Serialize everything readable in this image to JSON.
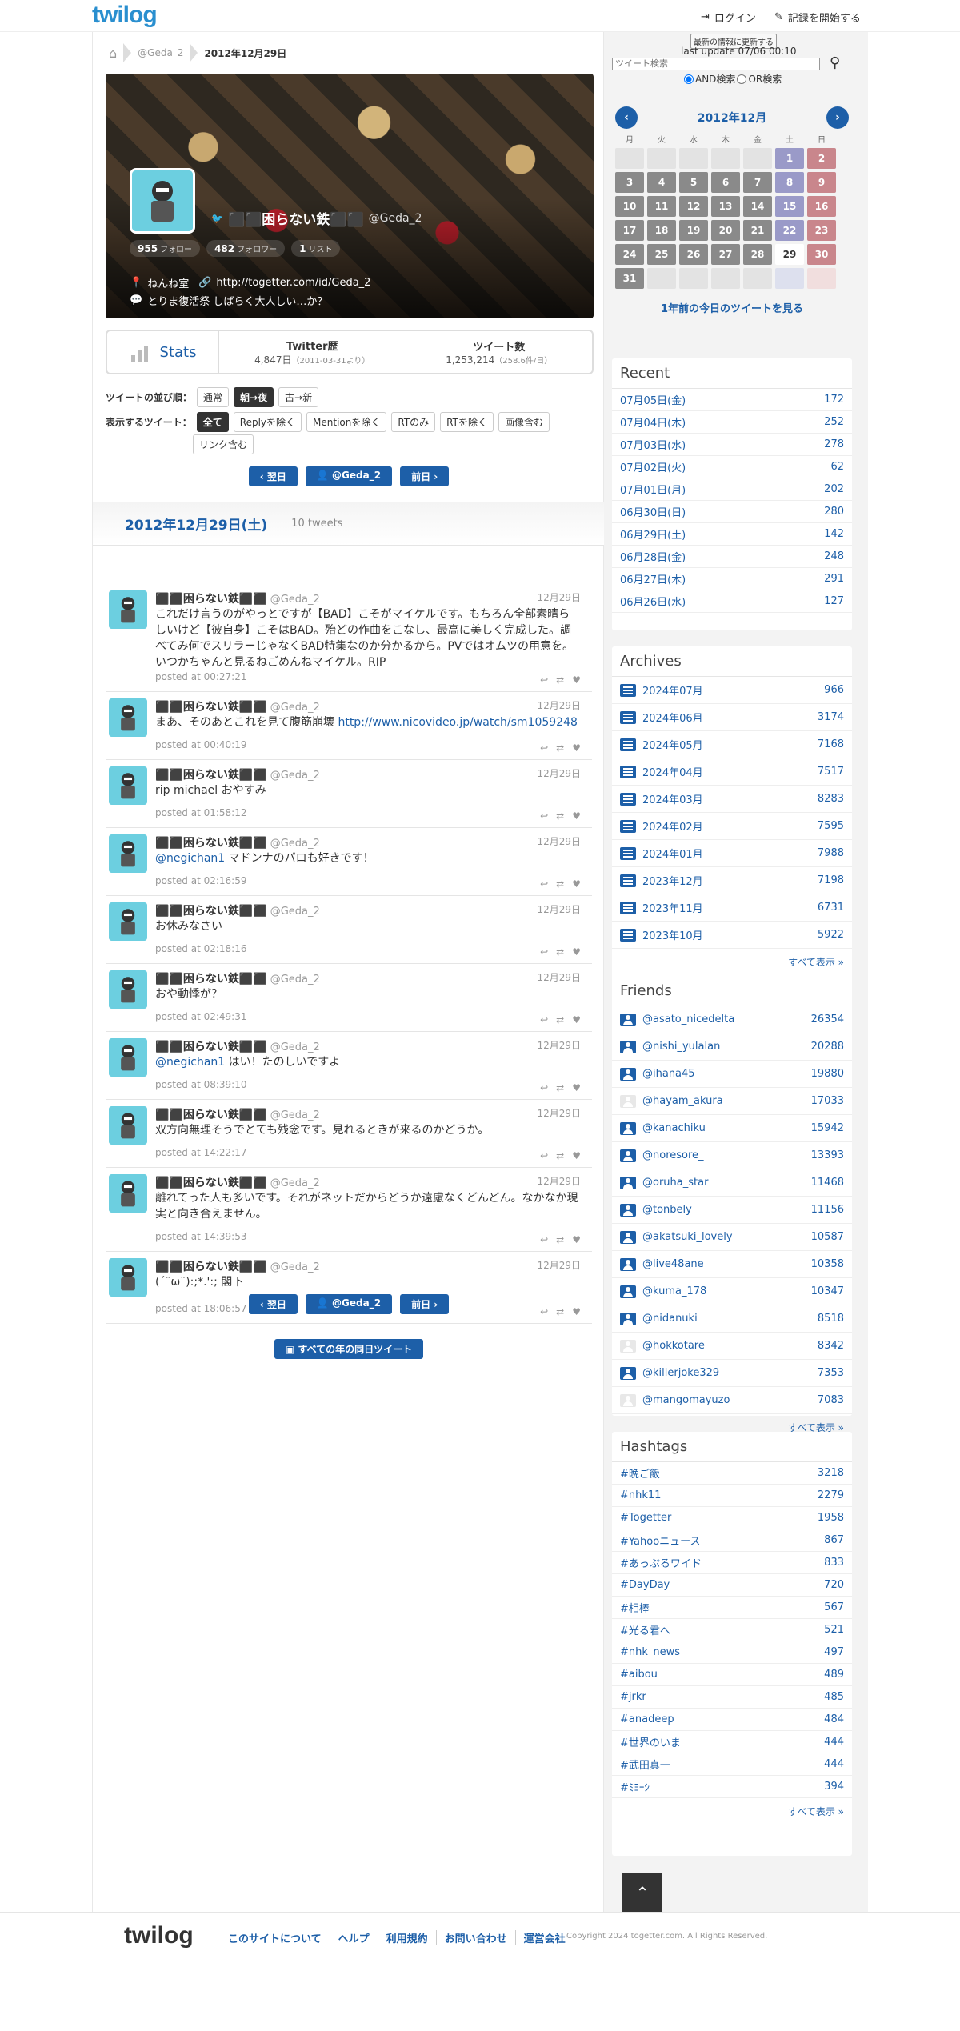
{
  "header": {
    "logo": "twilog",
    "login": "ログイン",
    "start": "記録を開始する"
  },
  "breadcrumb": {
    "user": "@Geda_2",
    "date": "2012年12月29日"
  },
  "profile": {
    "name": "⬛⬛困らない鉄⬛⬛",
    "handle": "@Geda_2",
    "follow_count": "955",
    "follow_label": "フォロー",
    "follower_count": "482",
    "follower_label": "フォロワー",
    "list_count": "1",
    "list_label": "リスト",
    "location": "ねんね室",
    "url": "http://togetter.com/id/Geda_2",
    "bio": "とりま復活祭 しばらく大人しい…か？"
  },
  "stats": {
    "label": "Stats",
    "history_title": "Twitter歴",
    "history_value": "4,847日",
    "history_sub": "（2011-03-31より）",
    "count_title": "ツイート数",
    "count_value": "1,253,214",
    "count_sub": "（258.6件/日）"
  },
  "filters": {
    "order_label": "ツイートの並び順：",
    "order": [
      "通常",
      "朝→夜",
      "古→新"
    ],
    "show_label": "表示するツイート：",
    "show": [
      "全て",
      "Replyを除く",
      "Mentionを除く",
      "RTのみ",
      "RTを除く",
      "画像含む"
    ],
    "show2": "リンク含む"
  },
  "nav": {
    "prev": "翌日",
    "user": "@Geda_2",
    "next": "前日",
    "all_years": "すべての年の同日ツイート"
  },
  "day": {
    "title": "2012年12月29日(土)",
    "count": "10 tweets"
  },
  "tweets": [
    {
      "name": "⬛⬛困らない鉄⬛⬛",
      "handle": "@Geda_2",
      "date": "12月29日",
      "text": "これだけ言うのがやっとですが【BAD】こそがマイケルです。もちろん全部素晴らしいけど【彼自身】こそはBAD。殆どの作曲をこなし、最高に美しく完成した。調べてみ何でスリラーじゃなくBAD特集なのか分かるから。PVではオムツの用意を。いつかちゃんと見るねごめんねマイケル。RIP",
      "posted": "posted at 00:27:21"
    },
    {
      "name": "⬛⬛困らない鉄⬛⬛",
      "handle": "@Geda_2",
      "date": "12月29日",
      "text": "まあ、そのあとこれを見て腹筋崩壊 ",
      "link": "http://www.nicovideo.jp/watch/sm1059248",
      "posted": "posted at 00:40:19"
    },
    {
      "name": "⬛⬛困らない鉄⬛⬛",
      "handle": "@Geda_2",
      "date": "12月29日",
      "text": "rip michael おやすみ",
      "posted": "posted at 01:58:12"
    },
    {
      "name": "⬛⬛困らない鉄⬛⬛",
      "handle": "@Geda_2",
      "date": "12月29日",
      "mention": "@negichan1",
      "text": " マドンナのパロも好きです！",
      "posted": "posted at 02:16:59"
    },
    {
      "name": "⬛⬛困らない鉄⬛⬛",
      "handle": "@Geda_2",
      "date": "12月29日",
      "text": "お休みなさい",
      "posted": "posted at 02:18:16"
    },
    {
      "name": "⬛⬛困らない鉄⬛⬛",
      "handle": "@Geda_2",
      "date": "12月29日",
      "text": "おや動悸が？",
      "posted": "posted at 02:49:31"
    },
    {
      "name": "⬛⬛困らない鉄⬛⬛",
      "handle": "@Geda_2",
      "date": "12月29日",
      "mention": "@negichan1",
      "text": " はい！たのしいですよ",
      "posted": "posted at 08:39:10"
    },
    {
      "name": "⬛⬛困らない鉄⬛⬛",
      "handle": "@Geda_2",
      "date": "12月29日",
      "text": "双方向無理そうでとても残念です。見れるときが来るのかどうか。",
      "posted": "posted at 14:22:17"
    },
    {
      "name": "⬛⬛困らない鉄⬛⬛",
      "handle": "@Geda_2",
      "date": "12月29日",
      "text": "離れてった人も多いです。それがネットだからどうか遠慮なくどんどん。なかなか現実と向き合えません。",
      "posted": "posted at 14:39:53"
    },
    {
      "name": "⬛⬛困らない鉄⬛⬛",
      "handle": "@Geda_2",
      "date": "12月29日",
      "text": "(´¨ω¨):;*.':; 閣下",
      "posted": "posted at 18:06:57"
    }
  ],
  "search": {
    "update_btn": "最新の情報に更新する",
    "last_update": "last update 07/06 00:10",
    "placeholder": "ツイート検索",
    "and": "AND検索",
    "or": "OR検索"
  },
  "calendar": {
    "title": "2012年12月",
    "weekdays": [
      "月",
      "火",
      "水",
      "木",
      "金",
      "土",
      "日"
    ],
    "days": [
      "",
      "",
      "",
      "",
      "",
      "1",
      "2",
      "3",
      "4",
      "5",
      "6",
      "7",
      "8",
      "9",
      "10",
      "11",
      "12",
      "13",
      "14",
      "15",
      "16",
      "17",
      "18",
      "19",
      "20",
      "21",
      "22",
      "23",
      "24",
      "25",
      "26",
      "27",
      "28",
      "29",
      "30",
      "31",
      "",
      "",
      "",
      "",
      "",
      ""
    ],
    "year_ago": "1年前の今日のツイートを見る"
  },
  "recent": {
    "title": "Recent",
    "items": [
      {
        "label": "07月05日(金)",
        "count": "172"
      },
      {
        "label": "07月04日(木)",
        "count": "252"
      },
      {
        "label": "07月03日(水)",
        "count": "278"
      },
      {
        "label": "07月02日(火)",
        "count": "62"
      },
      {
        "label": "07月01日(月)",
        "count": "202"
      },
      {
        "label": "06月30日(日)",
        "count": "280"
      },
      {
        "label": "06月29日(土)",
        "count": "142"
      },
      {
        "label": "06月28日(金)",
        "count": "248"
      },
      {
        "label": "06月27日(木)",
        "count": "291"
      },
      {
        "label": "06月26日(水)",
        "count": "127"
      }
    ]
  },
  "archives": {
    "title": "Archives",
    "more": "すべて表示 »",
    "items": [
      {
        "label": "2024年07月",
        "count": "966"
      },
      {
        "label": "2024年06月",
        "count": "3174"
      },
      {
        "label": "2024年05月",
        "count": "7168"
      },
      {
        "label": "2024年04月",
        "count": "7517"
      },
      {
        "label": "2024年03月",
        "count": "8283"
      },
      {
        "label": "2024年02月",
        "count": "7595"
      },
      {
        "label": "2024年01月",
        "count": "7988"
      },
      {
        "label": "2023年12月",
        "count": "7198"
      },
      {
        "label": "2023年11月",
        "count": "6731"
      },
      {
        "label": "2023年10月",
        "count": "5922"
      }
    ]
  },
  "friends": {
    "title": "Friends",
    "more": "すべて表示 »",
    "items": [
      {
        "label": "@asato_nicedelta",
        "count": "26354"
      },
      {
        "label": "@nishi_yulalan",
        "count": "20288"
      },
      {
        "label": "@ihana45",
        "count": "19880"
      },
      {
        "label": "@hayam_akura",
        "count": "17033"
      },
      {
        "label": "@kanachiku",
        "count": "15942"
      },
      {
        "label": "@noresore_",
        "count": "13393"
      },
      {
        "label": "@oruha_star",
        "count": "11468"
      },
      {
        "label": "@tonbely",
        "count": "11156"
      },
      {
        "label": "@akatsuki_lovely",
        "count": "10587"
      },
      {
        "label": "@live48ane",
        "count": "10358"
      },
      {
        "label": "@kuma_178",
        "count": "10347"
      },
      {
        "label": "@nidanuki",
        "count": "8518"
      },
      {
        "label": "@hokkotare",
        "count": "8342"
      },
      {
        "label": "@killerjoke329",
        "count": "7353"
      },
      {
        "label": "@mangomayuzo",
        "count": "7083"
      }
    ]
  },
  "hashtags": {
    "title": "Hashtags",
    "more": "すべて表示 »",
    "items": [
      {
        "label": "#晩ご飯",
        "count": "3218"
      },
      {
        "label": "#nhk11",
        "count": "2279"
      },
      {
        "label": "#Togetter",
        "count": "1958"
      },
      {
        "label": "#Yahooニュース",
        "count": "867"
      },
      {
        "label": "#あっぷるワイド",
        "count": "833"
      },
      {
        "label": "#DayDay",
        "count": "720"
      },
      {
        "label": "#相棒",
        "count": "567"
      },
      {
        "label": "#光る君へ",
        "count": "521"
      },
      {
        "label": "#nhk_news",
        "count": "497"
      },
      {
        "label": "#aibou",
        "count": "489"
      },
      {
        "label": "#jrkr",
        "count": "485"
      },
      {
        "label": "#anadeep",
        "count": "484"
      },
      {
        "label": "#世界のいま",
        "count": "444"
      },
      {
        "label": "#武田真一",
        "count": "444"
      },
      {
        "label": "#ﾐﾖｰｼ",
        "count": "394"
      }
    ]
  },
  "footer": {
    "logo": "twilog",
    "links": [
      "このサイトについて",
      "ヘルプ",
      "利用規約",
      "お問い合わせ",
      "運営会社"
    ],
    "copyright": "Copyright 2024 togetter.com. All Rights Reserved."
  },
  "colors": {
    "accent": "#1d5fa8",
    "logo": "#2a8fcf"
  }
}
